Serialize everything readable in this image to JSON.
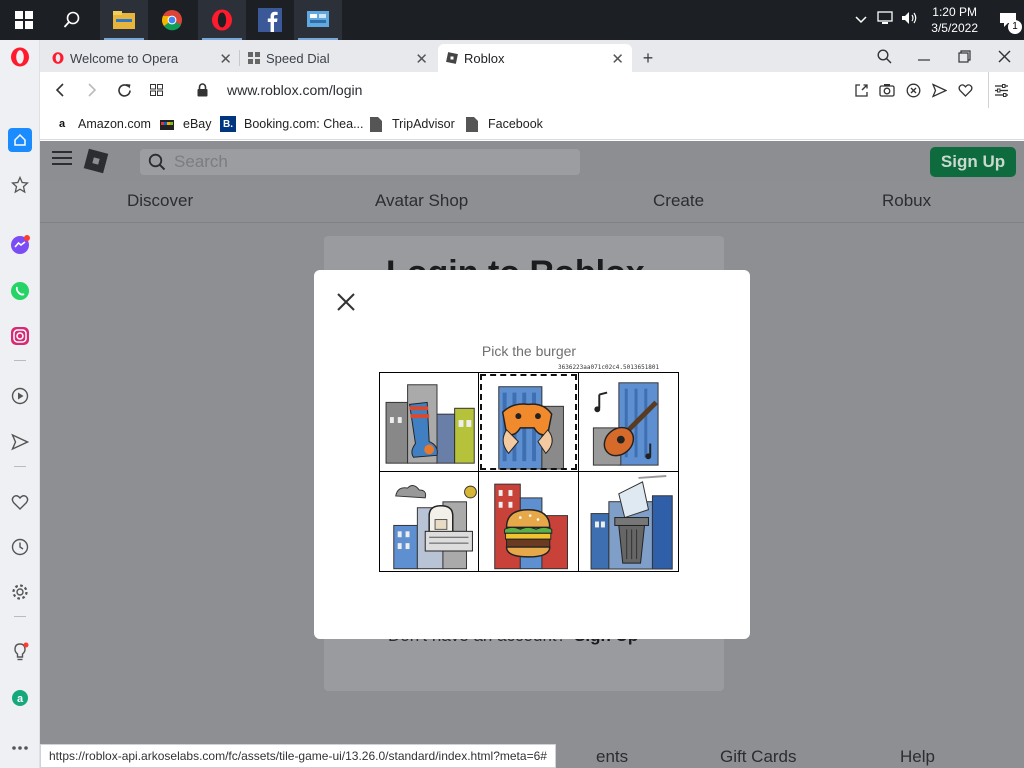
{
  "taskbar": {
    "apps": [
      {
        "name": "file-explorer"
      },
      {
        "name": "chrome"
      },
      {
        "name": "opera"
      },
      {
        "name": "facebook"
      },
      {
        "name": "control-panel"
      }
    ],
    "time": "1:20 PM",
    "date": "3/5/2022",
    "notification_count": "1"
  },
  "browser": {
    "tabs": [
      {
        "label": "Welcome to Opera",
        "active": false
      },
      {
        "label": "Speed Dial",
        "active": false
      },
      {
        "label": "Roblox",
        "active": true
      }
    ],
    "url": "www.roblox.com/login",
    "bookmarks": [
      {
        "label": "Amazon.com",
        "icon": "a"
      },
      {
        "label": "eBay",
        "icon": "ebay"
      },
      {
        "label": "Booking.com: Chea...",
        "icon": "B."
      },
      {
        "label": "TripAdvisor",
        "icon": "doc"
      },
      {
        "label": "Facebook",
        "icon": "doc"
      }
    ],
    "status_url": "https://roblox-api.arkoselabs.com/fc/assets/tile-game-ui/13.26.0/standard/index.html?meta=6#"
  },
  "roblox": {
    "search_placeholder": "Search",
    "signup_button": "Sign Up",
    "nav": [
      "Discover",
      "Avatar Shop",
      "Create",
      "Robux"
    ],
    "login_title": "Login to Roblox",
    "no_account_text": "Don't have an account?",
    "signup_link": "Sign Up",
    "footer_links": [
      "ents",
      "Gift Cards",
      "Help"
    ]
  },
  "captcha": {
    "prompt": "Pick the burger",
    "session_id": "3636223aa071c02c4.5013651801",
    "tiles": [
      {
        "subject": "sock"
      },
      {
        "subject": "game controller"
      },
      {
        "subject": "guitar"
      },
      {
        "subject": "bread"
      },
      {
        "subject": "burger"
      },
      {
        "subject": "trash can"
      }
    ],
    "focused_tile": 1
  },
  "colors": {
    "taskbar": "#1c1f24",
    "opera_red": "#ff1b2d",
    "signup_green": "#0d6b3e",
    "overlay": "#8d8f92"
  }
}
